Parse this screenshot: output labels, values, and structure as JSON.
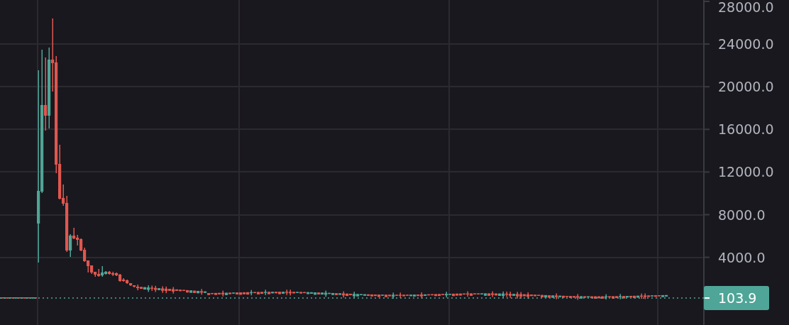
{
  "price_axis": {
    "labels": [
      "28000.0",
      "24000.0",
      "20000.0",
      "16000.0",
      "12000.0",
      "8000.0",
      "4000.0"
    ],
    "last_price": "103.9"
  }
}
